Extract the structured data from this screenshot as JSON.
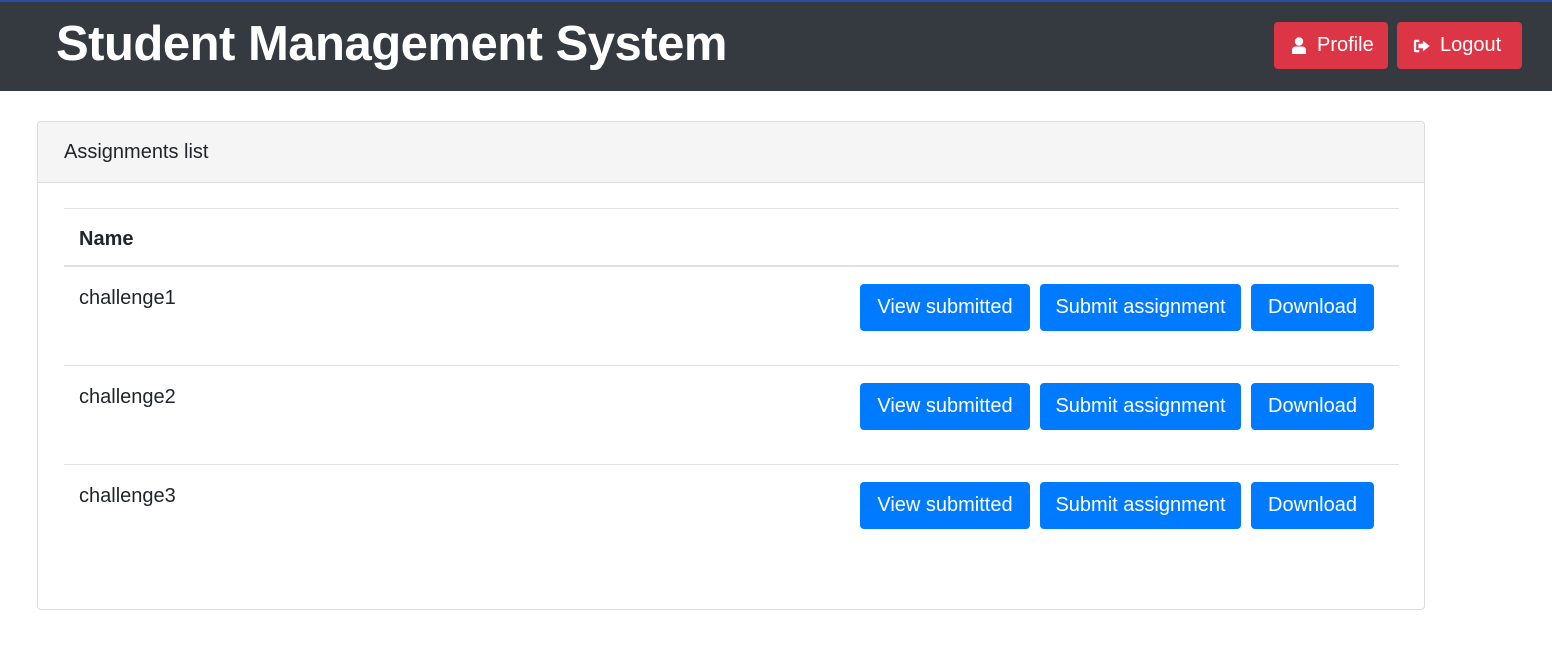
{
  "navbar": {
    "brand": "Student Management System",
    "profile_label": "Profile",
    "profile_icon": "user-icon",
    "logout_label": "Logout",
    "logout_icon": "sign-out-icon",
    "background": "#343a40",
    "button_color": "#dc3545"
  },
  "card": {
    "header": "Assignments list",
    "table": {
      "columns": [
        "Name"
      ],
      "rows": [
        {
          "name": "challenge1",
          "view_label": "View submitted",
          "submit_label": "Submit assignment",
          "download_label": "Download"
        },
        {
          "name": "challenge2",
          "view_label": "View submitted",
          "submit_label": "Submit assignment",
          "download_label": "Download"
        },
        {
          "name": "challenge3",
          "view_label": "View submitted",
          "submit_label": "Submit assignment",
          "download_label": "Download"
        }
      ]
    },
    "button_color": "#007bff"
  }
}
